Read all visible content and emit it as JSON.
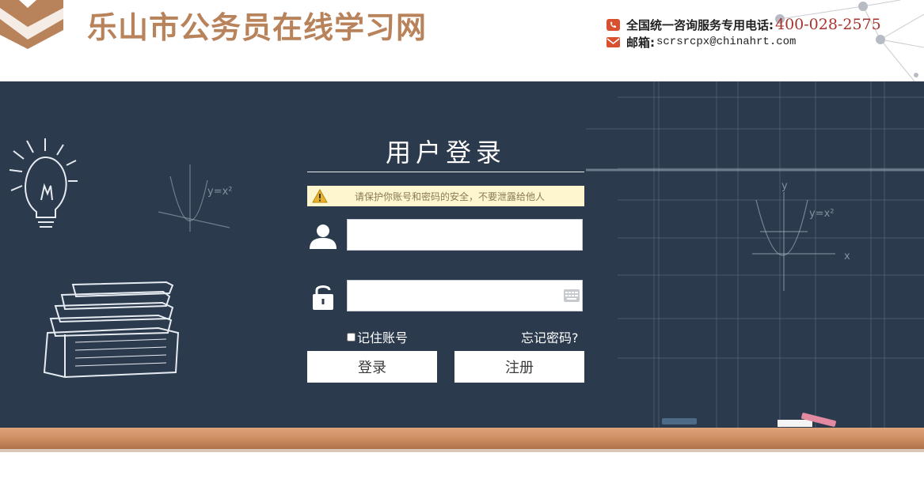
{
  "header": {
    "site_title": "乐山市公务员在线学习网",
    "phone_label": "全国统一咨询服务专用电话:",
    "phone_number": "400-028-2575",
    "email_label": "邮箱:",
    "email_address": "scrsrcpx@chinahrt.com"
  },
  "login": {
    "title": "用户登录",
    "notice": "请保护你账号和密码的安全，不要泄露给他人",
    "username": {
      "value": "",
      "placeholder": ""
    },
    "password": {
      "value": "",
      "placeholder": ""
    },
    "remember_label": "记住账号",
    "forgot_label": "忘记密码?",
    "login_button": "登录",
    "register_button": "注册"
  },
  "board_doodles": {
    "formula": "y=x²",
    "axis_x": "x",
    "axis_y": "y"
  },
  "icons": [
    "logo-chevron-icon",
    "phone-icon",
    "mail-icon",
    "warning-icon",
    "user-icon",
    "lock-icon",
    "keyboard-icon",
    "lightbulb-icon",
    "books-icon",
    "chalk-icon",
    "eraser-icon"
  ],
  "colors": {
    "brand": "#b8825a",
    "board": "#2b3a4d",
    "phone_number": "#a8332e",
    "notice_bg": "#fdf6cf",
    "ledge": "#c98a5e"
  }
}
